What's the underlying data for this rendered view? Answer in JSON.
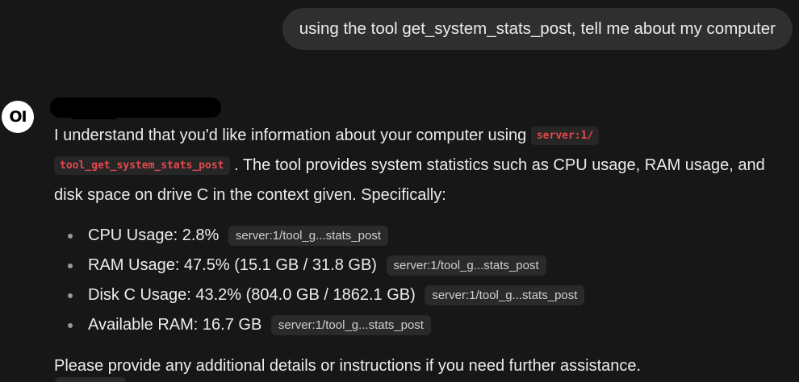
{
  "user_message": {
    "text": "using the tool get_system_stats_post, tell me about my computer"
  },
  "assistant": {
    "avatar_text": "OI",
    "intro": {
      "text_before_code": "I understand that you'd like information about your computer using ",
      "code_line1": "server:1/",
      "code_line2": "tool_get_system_stats_post",
      "text_after_code": ". The tool provides system statistics such as CPU usage, RAM usage, and disk space on drive C in the context given. Specifically:"
    },
    "stats": [
      {
        "text": "CPU Usage: 2.8%",
        "citation": "server:1/tool_g...stats_post"
      },
      {
        "text": "RAM Usage: 47.5% (15.1 GB / 31.8 GB)",
        "citation": "server:1/tool_g...stats_post"
      },
      {
        "text": "Disk C Usage: 43.2% (804.0 GB / 1862.1 GB)",
        "citation": "server:1/tool_g...stats_post"
      },
      {
        "text": "Available RAM: 16.7 GB",
        "citation": "server:1/tool_g...stats_post"
      }
    ],
    "closing": "Please provide any additional details or instructions if you need further assistance."
  },
  "colors": {
    "background": "#171717",
    "user_bubble": "#2f2f2f",
    "code_text": "#e5484d",
    "citation_bg": "#2a2a2a"
  }
}
